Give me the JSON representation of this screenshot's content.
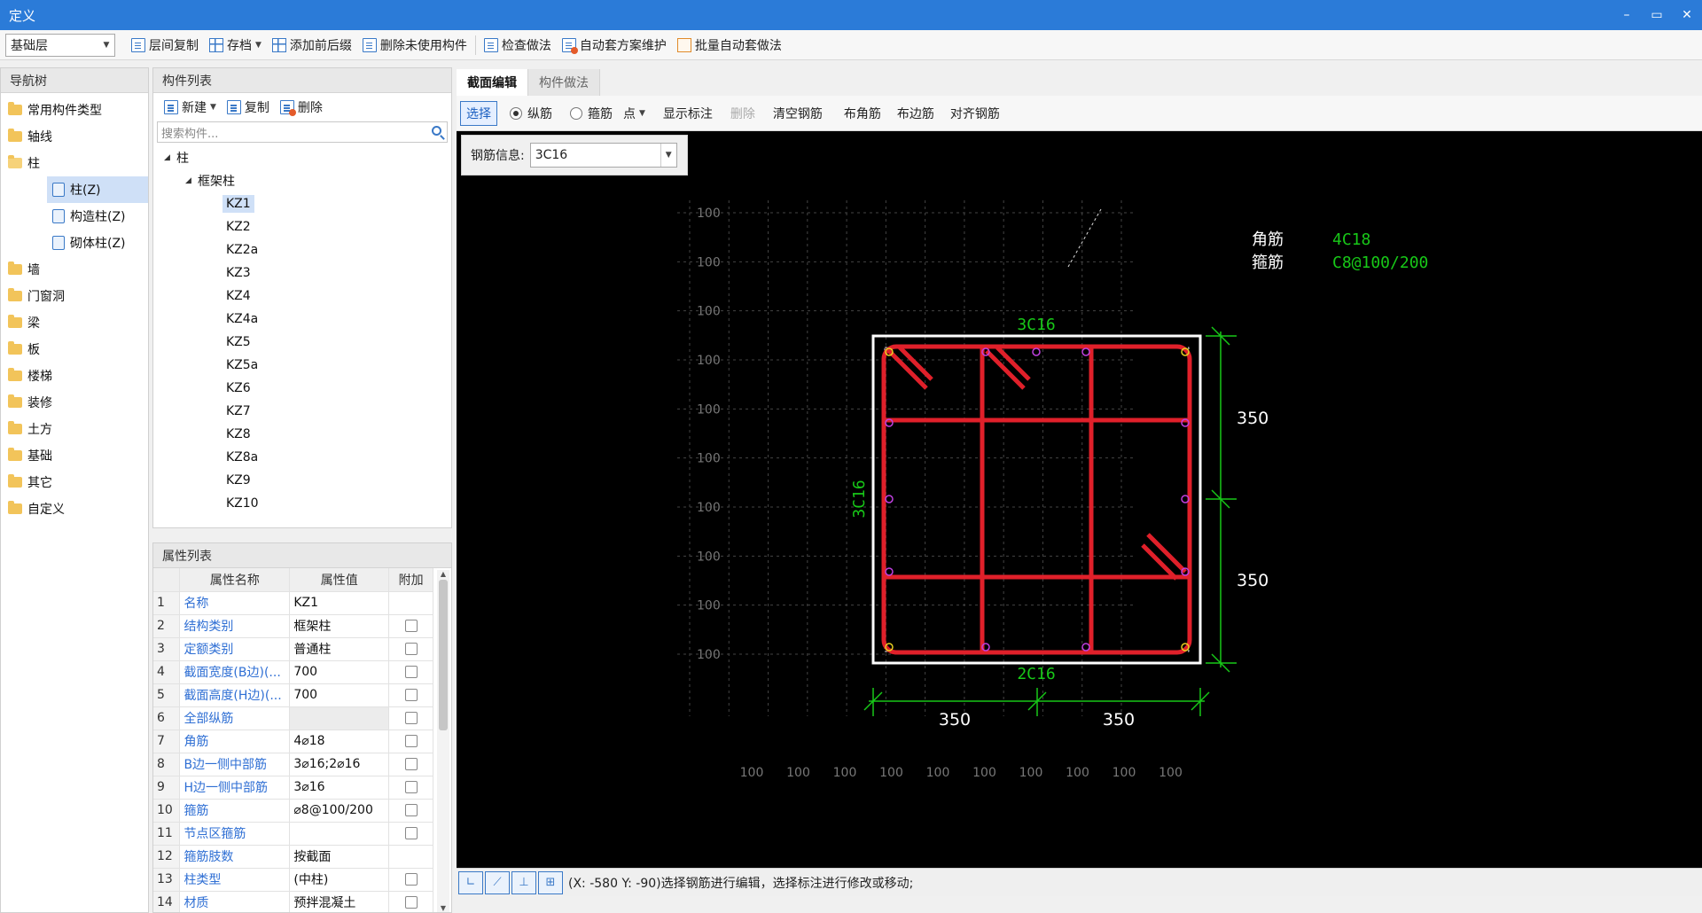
{
  "window": {
    "title": "定义",
    "minimize": "–",
    "restore": "▭",
    "close": "✕"
  },
  "toolbar": {
    "floor_select": "基础层",
    "items": [
      "层间复制",
      "存档",
      "添加前后缀",
      "删除未使用构件",
      "检查做法",
      "自动套方案维护",
      "批量自动套做法"
    ]
  },
  "nav": {
    "title": "导航树",
    "items": [
      {
        "label": "常用构件类型",
        "level": 0
      },
      {
        "label": "轴线",
        "level": 0
      },
      {
        "label": "柱",
        "level": 0
      },
      {
        "label": "柱(Z)",
        "level": 1
      },
      {
        "label": "构造柱(Z)",
        "level": 1
      },
      {
        "label": "砌体柱(Z)",
        "level": 1
      },
      {
        "label": "墙",
        "level": 0
      },
      {
        "label": "门窗洞",
        "level": 0
      },
      {
        "label": "梁",
        "level": 0
      },
      {
        "label": "板",
        "level": 0
      },
      {
        "label": "楼梯",
        "level": 0
      },
      {
        "label": "装修",
        "level": 0
      },
      {
        "label": "土方",
        "level": 0
      },
      {
        "label": "基础",
        "level": 0
      },
      {
        "label": "其它",
        "level": 0
      },
      {
        "label": "自定义",
        "level": 0
      }
    ]
  },
  "component_list": {
    "title": "构件列表",
    "new_label": "新建",
    "copy_label": "复制",
    "delete_label": "删除",
    "search_placeholder": "搜索构件...",
    "root": "柱",
    "group": "框架柱",
    "items": [
      "KZ1",
      "KZ2",
      "KZ2a",
      "KZ3",
      "KZ4",
      "KZ4a",
      "KZ5",
      "KZ5a",
      "KZ6",
      "KZ7",
      "KZ8",
      "KZ8a",
      "KZ9",
      "KZ10"
    ]
  },
  "properties": {
    "title": "属性列表",
    "headers": [
      "属性名称",
      "属性值",
      "附加"
    ],
    "rows": [
      {
        "n": "1",
        "name": "名称",
        "value": "KZ1",
        "check": false
      },
      {
        "n": "2",
        "name": "结构类别",
        "value": "框架柱",
        "check": true
      },
      {
        "n": "3",
        "name": "定额类别",
        "value": "普通柱",
        "check": true
      },
      {
        "n": "4",
        "name": "截面宽度(B边)(...",
        "value": "700",
        "check": true
      },
      {
        "n": "5",
        "name": "截面高度(H边)(...",
        "value": "700",
        "check": true
      },
      {
        "n": "6",
        "name": "全部纵筋",
        "value": "",
        "check": true
      },
      {
        "n": "7",
        "name": "角筋",
        "value": "4⌀18",
        "check": true
      },
      {
        "n": "8",
        "name": "B边一侧中部筋",
        "value": "3⌀16;2⌀16",
        "check": true
      },
      {
        "n": "9",
        "name": "H边一侧中部筋",
        "value": "3⌀16",
        "check": true
      },
      {
        "n": "10",
        "name": "箍筋",
        "value": "⌀8@100/200",
        "check": true
      },
      {
        "n": "11",
        "name": "节点区箍筋",
        "value": "",
        "check": true
      },
      {
        "n": "12",
        "name": "箍筋肢数",
        "value": "按截面",
        "check": false
      },
      {
        "n": "13",
        "name": "柱类型",
        "value": "(中柱)",
        "check": true
      },
      {
        "n": "14",
        "name": "材质",
        "value": "预拌混凝土",
        "check": true
      }
    ]
  },
  "tabs": [
    "截面编辑",
    "构件做法"
  ],
  "canvas_toolbar": {
    "select": "选择",
    "longitudinal": "纵筋",
    "stirrup": "箍筋",
    "point": "点",
    "show_label": "显示标注",
    "delete": "删除",
    "clear": "清空钢筋",
    "corner": "布角筋",
    "edge": "布边筋",
    "align": "对齐钢筋"
  },
  "rebar_info": {
    "label": "钢筋信息:",
    "value": "3C16"
  },
  "drawing": {
    "grid_label": "100",
    "legend_corner_label": "角筋",
    "legend_corner_value": "4C18",
    "legend_stirrup_label": "箍筋",
    "legend_stirrup_value": "C8@100/200",
    "top_label": "3C16",
    "left_label": "3C16",
    "bottom_label": "2C16",
    "dim_right_top": "350",
    "dim_right_bottom": "350",
    "dim_bottom_left": "350",
    "dim_bottom_right": "350"
  },
  "status": {
    "text": "(X: -580 Y: -90)选择钢筋进行编辑，选择标注进行修改或移动;"
  },
  "colors": {
    "titlebar": "#2b7bd8",
    "rebar": "#e0202a",
    "dim": "#18c818",
    "link": "#2f6fd4"
  }
}
